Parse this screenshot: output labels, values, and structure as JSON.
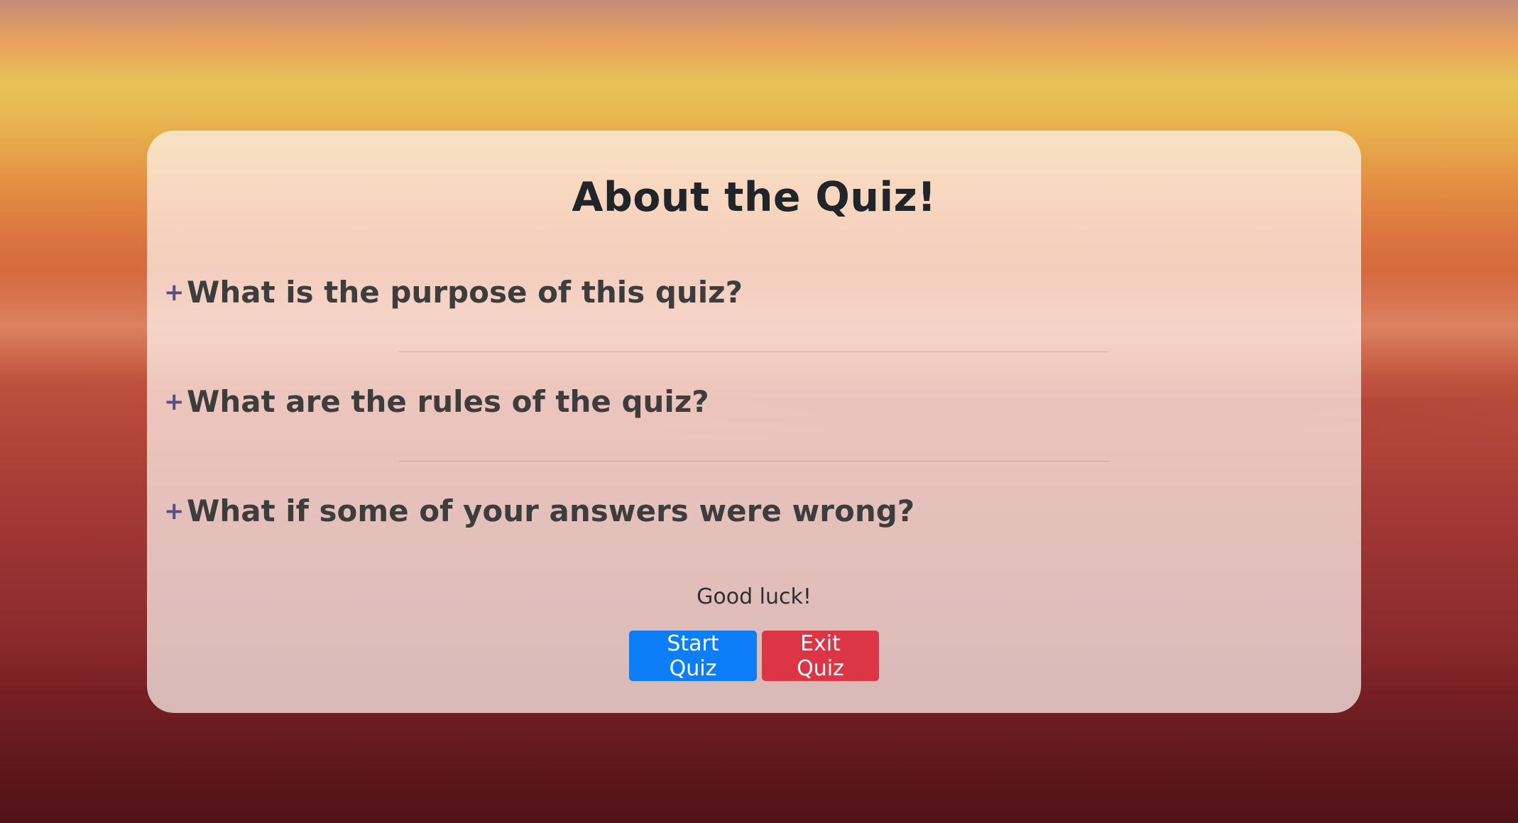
{
  "card": {
    "title": "About the Quiz!",
    "faq": [
      {
        "icon": "plus-icon",
        "symbol": "+",
        "question": "What is the purpose of this quiz?"
      },
      {
        "icon": "plus-icon",
        "symbol": "+",
        "question": "What are the rules of the quiz?"
      },
      {
        "icon": "plus-icon",
        "symbol": "+",
        "question": "What if some of your answers were wrong?"
      }
    ],
    "closing": "Good luck!",
    "buttons": {
      "start": "Start Quiz",
      "exit": "Exit Quiz"
    }
  },
  "colors": {
    "start_button": "#0d7ef8",
    "exit_button": "#dc3546",
    "plus_icon": "#5b4b86"
  }
}
